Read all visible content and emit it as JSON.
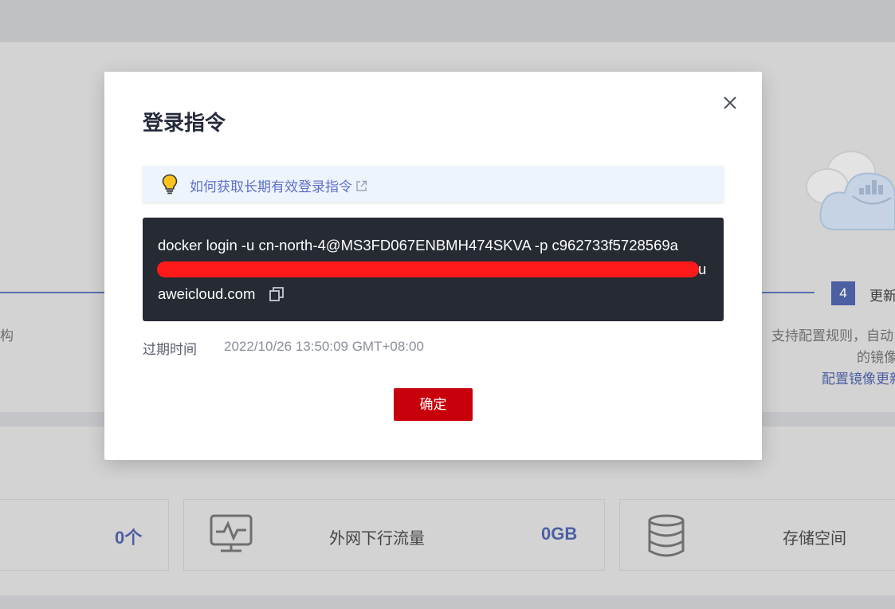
{
  "background": {
    "step": {
      "number": "4",
      "title": "更新",
      "left_text": "构",
      "desc_line1": "支持配置规则，自动",
      "desc_line2": "的镜像",
      "link": "配置镜像更新"
    },
    "stats": [
      {
        "value": "0个"
      },
      {
        "label": "外网下行流量",
        "value": "0GB",
        "icon": "network-monitor-icon"
      },
      {
        "label": "存储空间",
        "icon": "database-icon"
      }
    ]
  },
  "modal": {
    "title": "登录指令",
    "tip": {
      "icon": "lightbulb-icon",
      "link_text": "如何获取长期有效登录指令"
    },
    "command": {
      "line1": "docker login -u cn-north-4@MS3FD067ENBMH474SKVA -p c962733f5728569a",
      "line2_tail": "u",
      "line3": "aweicloud.com"
    },
    "expire": {
      "label": "过期时间",
      "value": "2022/10/26 13:50:09 GMT+08:00"
    },
    "confirm_label": "确定"
  },
  "colors": {
    "accent": "#4d5fa3",
    "link": "#5d70c9",
    "primary_button": "#c7000b",
    "code_bg": "#252a33",
    "redaction": "#ff1a1a"
  }
}
